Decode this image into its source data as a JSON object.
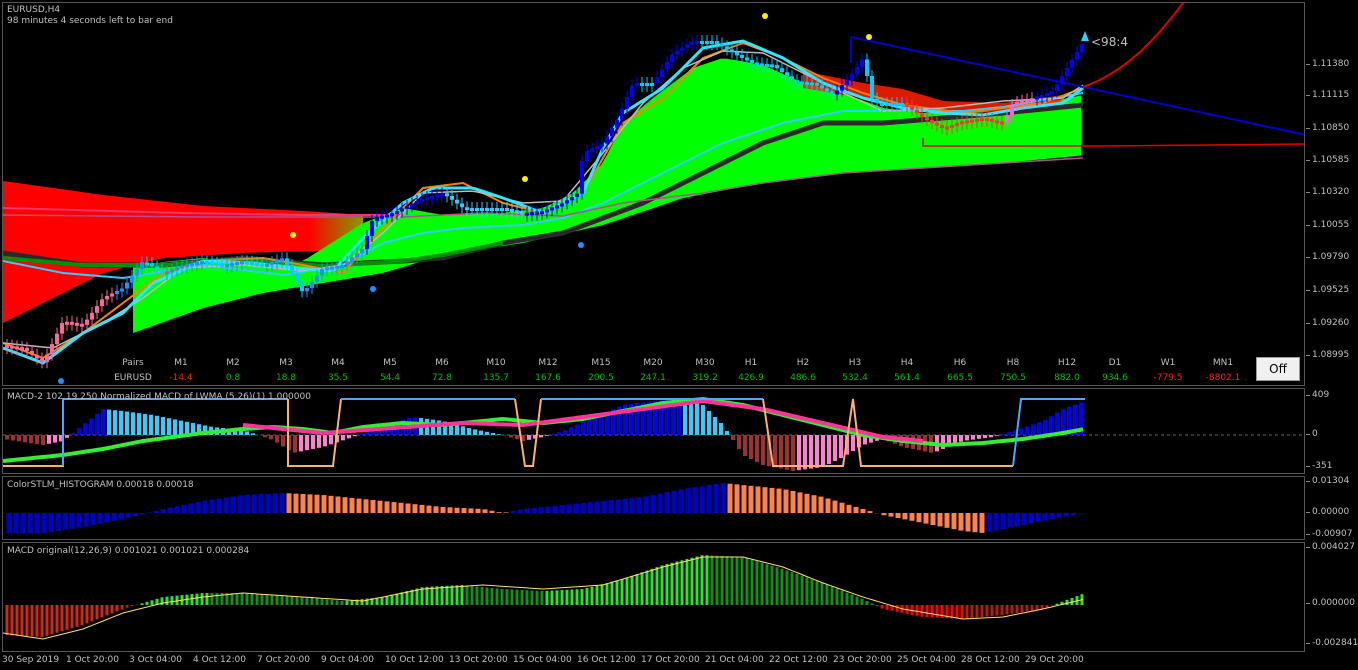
{
  "main": {
    "symbol": "EURUSD,H4",
    "countdown": "98 minutes 4 seconds left to bar end",
    "badge": "<98:4",
    "price_scale": [
      "1.11380",
      "1.11115",
      "1.10850",
      "1.10585",
      "1.10320",
      "1.10055",
      "1.09790",
      "1.09525",
      "1.09260",
      "1.08995"
    ]
  },
  "pairs_table": {
    "row1_label": "Pairs",
    "row2_label": "EURUSD",
    "timeframes": [
      "M1",
      "M2",
      "M3",
      "M4",
      "M5",
      "M6",
      "M10",
      "M12",
      "M15",
      "M20",
      "M30",
      "H1",
      "H2",
      "H3",
      "H4",
      "H6",
      "H8",
      "H12",
      "D1",
      "W1",
      "MN1"
    ],
    "values": [
      "-14.4",
      "0.8",
      "18.8",
      "35.5",
      "54.4",
      "72.8",
      "135.7",
      "167.6",
      "200.5",
      "247.1",
      "319.2",
      "426.9",
      "486.6",
      "532.4",
      "561.4",
      "665.5",
      "750.5",
      "882.0",
      "934.6",
      "-779.5",
      "-8802.1"
    ],
    "positive_color": "#00c000",
    "negative_color": "#ff2020",
    "off_button": "Off"
  },
  "macd2": {
    "title": "MACD-2 102 19 250 Normalized MACD of LWMA (5,26)(1) 1.000000",
    "scale": [
      "409",
      "0",
      "-351"
    ]
  },
  "stlm": {
    "title": "ColorSTLM_HISTOGRAM 0.00018 0.00018",
    "scale": [
      "0.01304",
      "0.00000",
      "-0.00907"
    ]
  },
  "macd": {
    "title": "MACD original(12,26,9) 0.001021 0.001021 0.000284",
    "scale": [
      "0.004027",
      "0.000000",
      "-0.002841"
    ]
  },
  "time_axis": [
    "30 Sep 2019",
    "1 Oct 20:00",
    "3 Oct 04:00",
    "4 Oct 12:00",
    "7 Oct 20:00",
    "9 Oct 04:00",
    "10 Oct 12:00",
    "13 Oct 20:00",
    "15 Oct 04:00",
    "16 Oct 12:00",
    "17 Oct 20:00",
    "21 Oct 04:00",
    "22 Oct 12:00",
    "23 Oct 20:00",
    "25 Oct 04:00",
    "28 Oct 12:00",
    "29 Oct 20:00"
  ],
  "colors": {
    "bull_cloud": "#00ff00",
    "bear_cloud": "#ff0000",
    "trendline": "#0000c8",
    "cyan_line": "#33ccff",
    "orange_line": "#ff8000"
  }
}
